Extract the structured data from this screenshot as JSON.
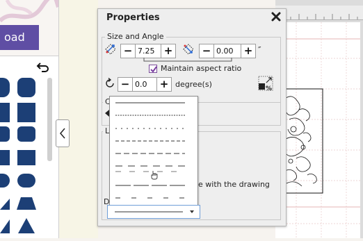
{
  "left_panel": {
    "load_label": "oad"
  },
  "dialog": {
    "title": "Properties",
    "size_angle": {
      "legend": "Size and Angle",
      "width_value": "7.25",
      "height_value": "0.00",
      "unit": "″",
      "maintain_aspect_label": "Maintain aspect ratio",
      "maintain_aspect_checked": true,
      "rotate_value": "0.0",
      "rotate_unit": "degree(s)"
    },
    "second_group_legend": "C",
    "line_group": {
      "legend": "L",
      "scale_text": "e with the drawing",
      "dropdown_label": "D"
    }
  },
  "line_styles": [
    {
      "name": "solid-thin"
    },
    {
      "name": "dotted-fine"
    },
    {
      "name": "dash-dot"
    },
    {
      "name": "short-dash"
    },
    {
      "name": "medium-dash"
    },
    {
      "name": "long-dash"
    },
    {
      "name": "dash-gap"
    },
    {
      "name": "long-short-dash"
    },
    {
      "name": "sparse-dash"
    }
  ]
}
